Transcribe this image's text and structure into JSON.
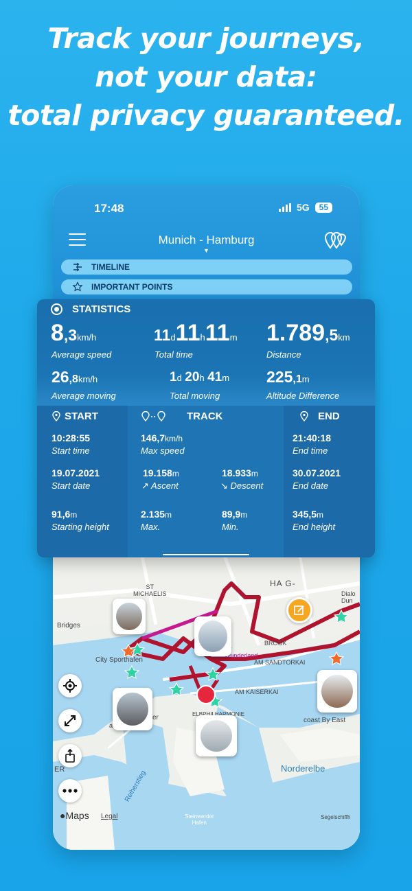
{
  "headline": [
    "Track your journeys,",
    "not your data:",
    "total privacy guaranteed."
  ],
  "status": {
    "time": "17:48",
    "network": "5G",
    "battery": "55"
  },
  "header": {
    "trip_title": "Munich - Hamburg",
    "caret": "▼"
  },
  "tabs": [
    {
      "label": "TIMELINE",
      "icon": "timeline-icon"
    },
    {
      "label": "IMPORTANT POINTS",
      "icon": "star-icon"
    }
  ],
  "statistics": {
    "title": "STATISTICS",
    "avg_speed": {
      "int": "8",
      "dec": ",3",
      "unit": "km/h",
      "label": "Average speed"
    },
    "total_time": {
      "d": "11",
      "d_unit": "d",
      "h": "11",
      "h_unit": "h",
      "m": "11",
      "m_unit": "m",
      "label": "Total time"
    },
    "distance": {
      "int": "1.789",
      "dec": ",5",
      "unit": "km",
      "label": "Distance"
    },
    "avg_moving": {
      "int": "26",
      "dec": ",8",
      "unit": "km/h",
      "label": "Average moving"
    },
    "total_moving": {
      "d": "1",
      "d_unit": "d",
      "h": "20",
      "h_unit": "h",
      "m": "41",
      "m_unit": "m",
      "label": "Total moving"
    },
    "altitude_diff": {
      "int": "225",
      "dec": ",1",
      "unit": "m",
      "label": "Altitude Difference"
    }
  },
  "start": {
    "title": "START",
    "time": "10:28:55",
    "time_label": "Start time",
    "date": "19.07.2021",
    "date_label": "Start date",
    "height": "91,6",
    "height_unit": "m",
    "height_label": "Starting height"
  },
  "track": {
    "title": "TRACK",
    "max_speed": "146,7",
    "max_speed_unit": "km/h",
    "max_speed_label": "Max speed",
    "ascent": "19.158",
    "ascent_unit": "m",
    "ascent_label": "Ascent",
    "descent": "18.933",
    "descent_unit": "m",
    "descent_label": "Descent",
    "max": "2.135",
    "max_unit": "m",
    "max_label": "Max.",
    "min": "89,9",
    "min_unit": "m",
    "min_label": "Min."
  },
  "end": {
    "title": "END",
    "time": "21:40:18",
    "time_label": "End time",
    "date": "30.07.2021",
    "date_label": "End date",
    "height": "345,5",
    "height_unit": "m",
    "height_label": "End height"
  },
  "map": {
    "labels": {
      "st_michaelis": "ST\nMICHAELIS",
      "bridges": "Bridges",
      "sporthafen": "City Sporthafen",
      "kaiserkai": "AM KAISERKAI",
      "sandtorkai": "AM SANDTORKAI",
      "brook": "BROOK",
      "elbphil": "ELBPHILHARMONIE",
      "coast": "coast By East",
      "norderelbe": "Norderelbe",
      "reiherstieg": "Reiherstieg",
      "steinwerder": "Steinwerder\nHafen",
      "segelschiff": "Segelschiffh",
      "dialog": "Dialo\nDun",
      "hamburg_frag": "HA  G-",
      "wunderland": "tur\nWunderland",
      "er": "er",
      "er2": "ER",
      "landungs": "an..."
    },
    "maps_logo": "Maps",
    "legal": "Legal",
    "accent_route": "#b0132e",
    "star_color": "#2fd3a4"
  }
}
